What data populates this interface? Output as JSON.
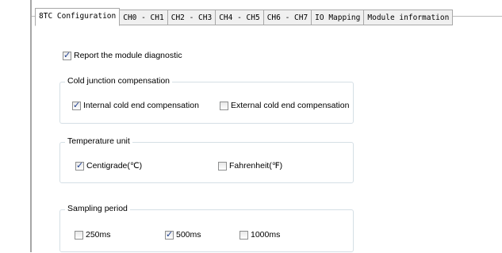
{
  "tabs": [
    {
      "label": "8TC Configuration",
      "active": true
    },
    {
      "label": "CH0 - CH1",
      "active": false
    },
    {
      "label": "CH2 - CH3",
      "active": false
    },
    {
      "label": "CH4 - CH5",
      "active": false
    },
    {
      "label": "CH6 - CH7",
      "active": false
    },
    {
      "label": "IO Mapping",
      "active": false
    },
    {
      "label": "Module information",
      "active": false
    }
  ],
  "report_diagnostic": {
    "label": "Report the module diagnostic",
    "checked": true
  },
  "cold_junction": {
    "title": "Cold junction compensation",
    "internal": {
      "label": "Internal cold end compensation",
      "checked": true
    },
    "external": {
      "label": "External cold end compensation",
      "checked": false
    }
  },
  "temperature_unit": {
    "title": "Temperature unit",
    "centigrade": {
      "label": "Centigrade(℃)",
      "checked": true
    },
    "fahrenheit": {
      "label": "Fahrenheit(℉)",
      "checked": false
    }
  },
  "sampling_period": {
    "title": "Sampling period",
    "ms250": {
      "label": "250ms",
      "checked": false
    },
    "ms500": {
      "label": "500ms",
      "checked": true
    },
    "ms1000": {
      "label": "1000ms",
      "checked": false
    }
  }
}
